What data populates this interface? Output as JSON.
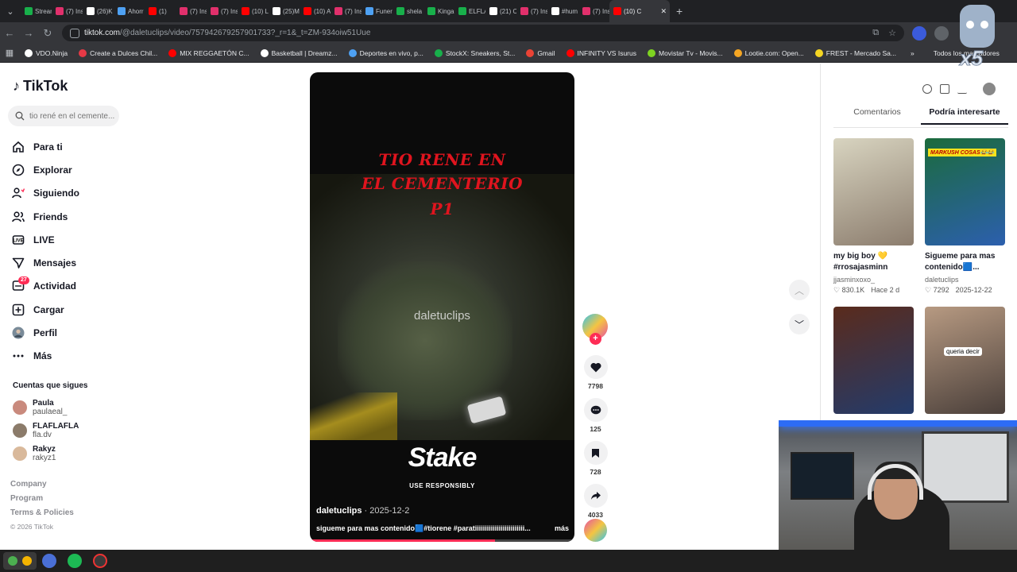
{
  "browser": {
    "tabs": [
      {
        "label": "Stream",
        "color": "#18b04b"
      },
      {
        "label": "(7) Ins",
        "color": "#e1306c"
      },
      {
        "label": "(26)K",
        "color": "#ffffff"
      },
      {
        "label": "Ahorr",
        "color": "#4ea1f3"
      },
      {
        "label": "(1)",
        "color": "#ff0000"
      },
      {
        "label": "(7) Ins",
        "color": "#e1306c"
      },
      {
        "label": "(7) Ins",
        "color": "#e1306c"
      },
      {
        "label": "(10) L",
        "color": "#ff0000"
      },
      {
        "label": "(25)M",
        "color": "#ffffff"
      },
      {
        "label": "(10) A",
        "color": "#ff0000"
      },
      {
        "label": "(7) Ins",
        "color": "#e1306c"
      },
      {
        "label": "Funer",
        "color": "#4ea1f3"
      },
      {
        "label": "shela",
        "color": "#18b04b"
      },
      {
        "label": "Kinga",
        "color": "#18b04b"
      },
      {
        "label": "ELFLA",
        "color": "#18b04b"
      },
      {
        "label": "(21) C",
        "color": "#ffffff"
      },
      {
        "label": "(7) Ins",
        "color": "#e1306c"
      },
      {
        "label": "#hum",
        "color": "#ffffff"
      },
      {
        "label": "(7) Ins",
        "color": "#e1306c"
      },
      {
        "label": "(10) C",
        "color": "#ff0000"
      }
    ],
    "url_host": "tiktok.com",
    "url_path": "/@daletuclips/video/7579426792579017​33?_r=1&_t=ZM-934oiw51Uue",
    "bookmarks": [
      {
        "label": "VDO.Ninja",
        "color": "#ffffff"
      },
      {
        "label": "Create a Dulces Chil...",
        "color": "#e63946"
      },
      {
        "label": "MIX REGGAETÓN C...",
        "color": "#ff0000"
      },
      {
        "label": "Basketball | Dreamz...",
        "color": "#ffffff"
      },
      {
        "label": "Deportes en vivo, p...",
        "color": "#4ea1f3"
      },
      {
        "label": "StockX: Sneakers, St...",
        "color": "#18b04b"
      },
      {
        "label": "Gmail",
        "color": "#ea4335"
      },
      {
        "label": "INFINITY VS Isurus",
        "color": "#ff0000"
      },
      {
        "label": "Movistar Tv - Movis...",
        "color": "#7ed321"
      },
      {
        "label": "Lootie.com: Open...",
        "color": "#f5a623"
      },
      {
        "label": "FREST - Mercado Sa...",
        "color": "#f5d623"
      }
    ],
    "bookmarks_overflow": "»",
    "bookmarks_folder": "Todos los marcadores"
  },
  "sidebar": {
    "logo": "TikTok",
    "search_placeholder": "tio rené en el cemente...",
    "nav": [
      {
        "label": "Para ti",
        "icon": "home-icon"
      },
      {
        "label": "Explorar",
        "icon": "compass-icon"
      },
      {
        "label": "Siguiendo",
        "icon": "following-icon"
      },
      {
        "label": "Friends",
        "icon": "friends-icon"
      },
      {
        "label": "LIVE",
        "icon": "live-icon"
      },
      {
        "label": "Mensajes",
        "icon": "messages-icon"
      },
      {
        "label": "Actividad",
        "icon": "activity-icon",
        "badge": "27"
      },
      {
        "label": "Cargar",
        "icon": "upload-icon"
      },
      {
        "label": "Perfil",
        "icon": "profile-icon"
      },
      {
        "label": "Más",
        "icon": "more-icon"
      }
    ],
    "following_title": "Cuentas que sigues",
    "following": [
      {
        "name": "Paula",
        "handle": "paulaeal_",
        "color": "#c98a7d"
      },
      {
        "name": "FLAFLAFLA",
        "handle": "fla.dv",
        "color": "#8b7b6a"
      },
      {
        "name": "Rakyz",
        "handle": "rakyz1",
        "color": "#d9b99b"
      }
    ],
    "footer": [
      "Company",
      "Program",
      "Terms & Policies"
    ],
    "copyright": "© 2026 TikTok"
  },
  "video": {
    "title_lines": [
      "TIO RENE EN",
      "EL CEMENTERIO",
      "P1"
    ],
    "watermark": "daletuclips",
    "sponsor": "Stake",
    "sponsor_sub": "USE RESPONSIBLY",
    "author": "daletuclips",
    "date": "2025-12-2",
    "caption": "sigueme para mas contenido🟦#tiorene #paratiiiiiiiiiiiiiiiiiiiiiiiii...",
    "more": "más",
    "progress": 0.7
  },
  "actions": {
    "likes": "7798",
    "comments": "125",
    "saves": "728",
    "shares": "4033"
  },
  "right_panel": {
    "tabs": [
      "Comentarios",
      "Podría interesarte"
    ],
    "active_tab": 1,
    "cards": [
      {
        "title": "my big boy 💛 #rrosajasminn",
        "user": "jjasminxoxo_",
        "likes": "830.1K",
        "time": "Hace 2 d",
        "colors": [
          "#d8d4c0",
          "#8c7d6e"
        ]
      },
      {
        "title": "Sigueme para mas contenido🟦...",
        "user": "daletuclips",
        "likes": "7292",
        "time": "2025-12-22",
        "colors": [
          "#1b6b3c",
          "#2c5fae"
        ],
        "tag": "MARKUSH COSAS😂😂"
      },
      {
        "title": "",
        "user": "",
        "likes": "",
        "time": "",
        "colors": [
          "#5a2b1c",
          "#233b6b"
        ]
      },
      {
        "title": "",
        "user": "",
        "likes": "",
        "time": "",
        "colors": [
          "#b79a82",
          "#4a3f3a"
        ],
        "caption": "queria decir"
      }
    ]
  },
  "overlay": {
    "sticker_text": "x5"
  }
}
